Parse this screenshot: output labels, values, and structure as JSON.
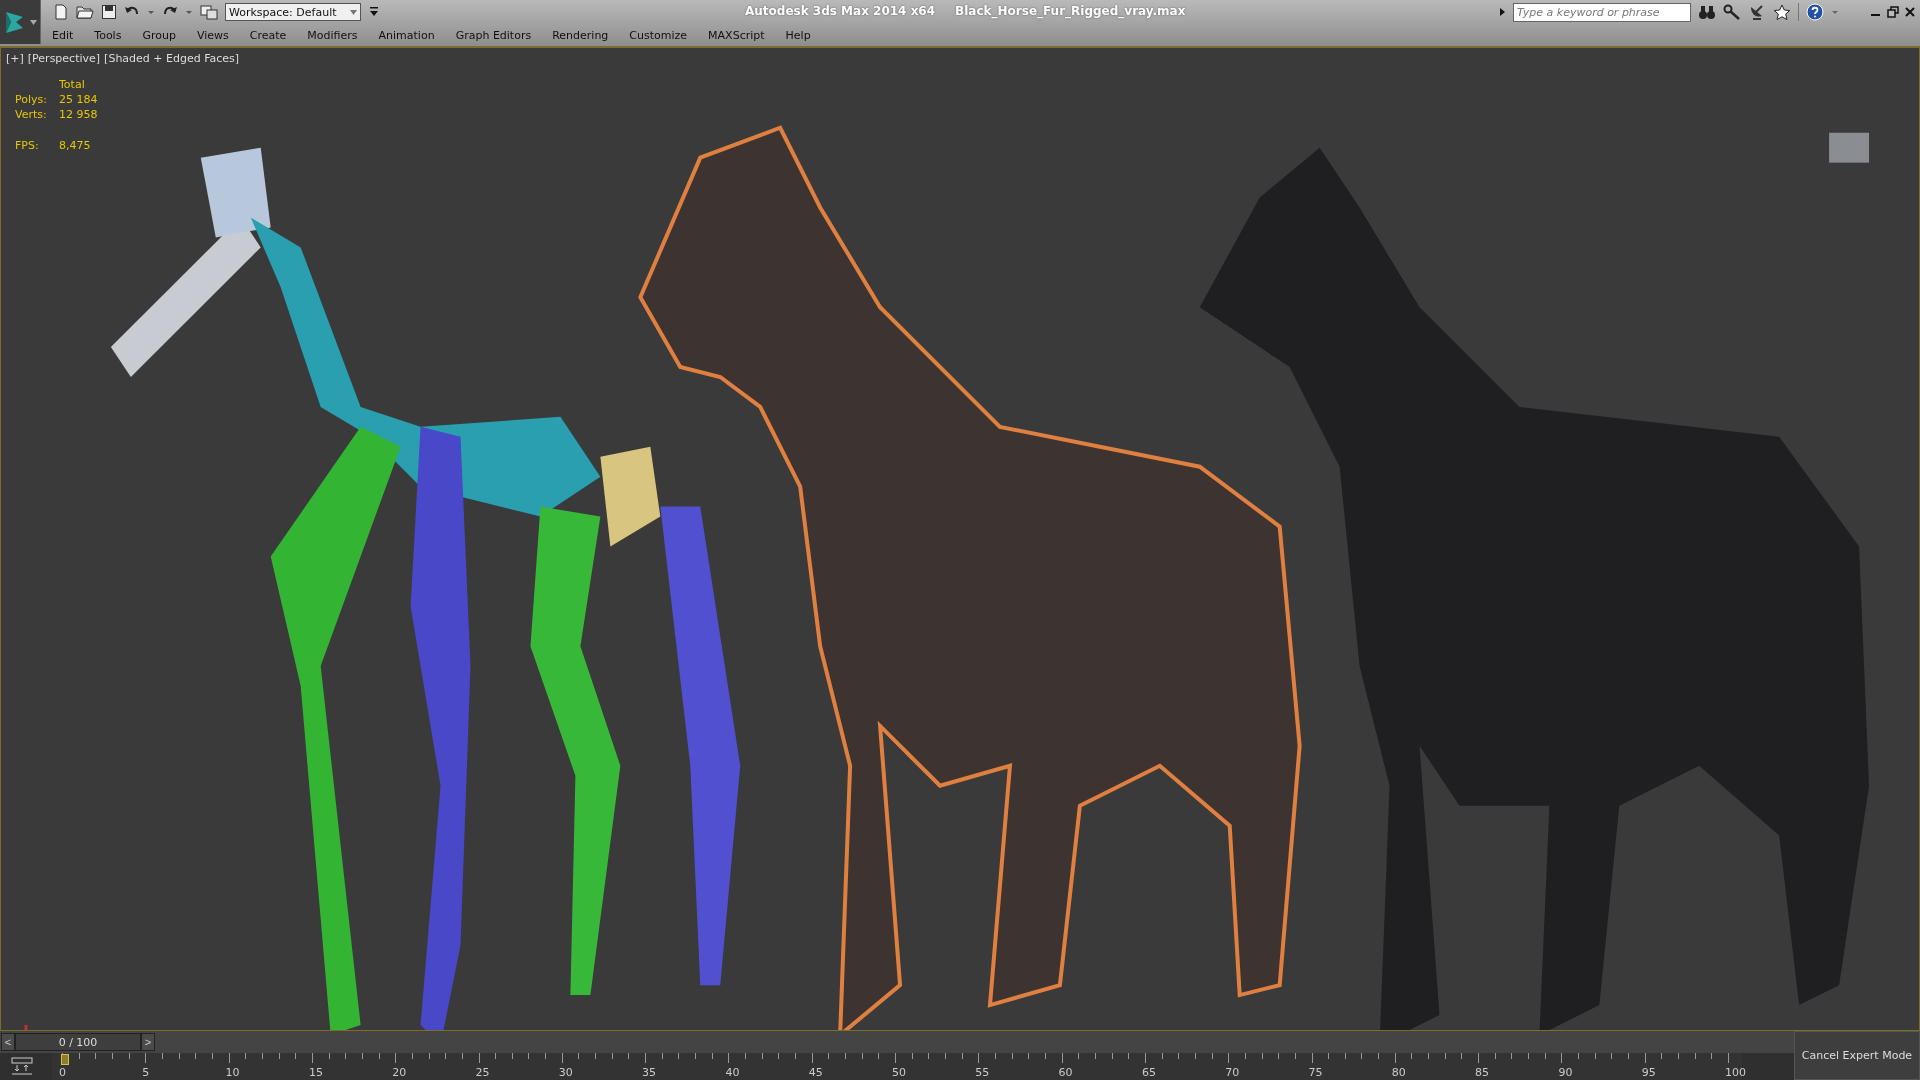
{
  "title_bar": {
    "app_title": "Autodesk 3ds Max  2014 x64",
    "file_name": "Black_Horse_Fur_Rigged_vray.max",
    "workspace": "Workspace: Default",
    "search": {
      "placeholder": "Type a keyword or phrase"
    }
  },
  "menu": [
    "Edit",
    "Tools",
    "Group",
    "Views",
    "Create",
    "Modifiers",
    "Animation",
    "Graph Editors",
    "Rendering",
    "Customize",
    "MAXScript",
    "Help"
  ],
  "viewport": {
    "labels": [
      "[+]",
      "[Perspective]",
      "[Shaded + Edged Faces]"
    ],
    "stats": {
      "header": "Total",
      "rows": [
        {
          "label": "Polys:",
          "value": "25 184"
        },
        {
          "label": "Verts:",
          "value": "12 958"
        }
      ],
      "fps_label": "FPS:",
      "fps_value": "8,475"
    }
  },
  "time_slider": {
    "prev": "<",
    "position": "0 / 100",
    "next": ">",
    "level": 0
  },
  "track_bar": {
    "labels": [
      "0",
      "5",
      "10",
      "15",
      "20",
      "25",
      "30",
      "35",
      "40",
      "45",
      "50",
      "55",
      "60",
      "65",
      "70",
      "75",
      "80",
      "85",
      "90",
      "95",
      "100"
    ]
  },
  "cancel_button": "Cancel Expert Mode"
}
